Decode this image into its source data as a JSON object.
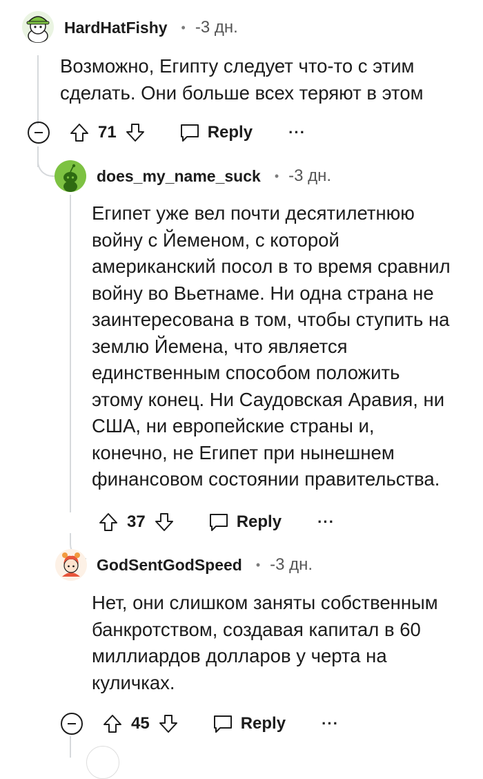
{
  "comments": [
    {
      "username": "HardHatFishy",
      "separator": "•",
      "time": "-3 дн.",
      "text": "Возможно, Египту следует что-то с этим\nсделать. Они больше всех теряют в этом",
      "score": "71",
      "reply_label": "Reply",
      "more_label": "···"
    },
    {
      "username": "does_my_name_suck",
      "separator": "•",
      "time": "-3 дн.",
      "text": "Египет уже вел почти десятилетнюю\nвойну с Йеменом, с которой\nамериканский посол в то время сравнил\nвойну во Вьетнаме. Ни одна страна не\nзаинтересована в том, чтобы ступить на\nземлю Йемена, что является\nединственным способом положить\nэтому конец. Ни Саудовская Аравия, ни\nСША, ни европейские страны и,\nконечно, не Египет при нынешнем\nфинансовом состоянии правительства.",
      "score": "37",
      "reply_label": "Reply",
      "more_label": "···"
    },
    {
      "username": "GodSentGodSpeed",
      "separator": "•",
      "time": "-3 дн.",
      "text": "Нет, они слишком заняты собственным\nбанкротством, создавая капитал в 60\nмиллиардов долларов у черта на\nкуличках.",
      "score": "45",
      "reply_label": "Reply",
      "more_label": "···"
    }
  ],
  "icons": {
    "upvote": "arrow-up-icon",
    "downvote": "arrow-down-icon",
    "reply": "speech-bubble-icon",
    "collapse": "minus-circle-icon"
  },
  "colors": {
    "text": "#1c1c1c",
    "meta": "#7c7c7c",
    "thread_line": "#d6d9dc",
    "avatar_green": "#7dc242"
  }
}
